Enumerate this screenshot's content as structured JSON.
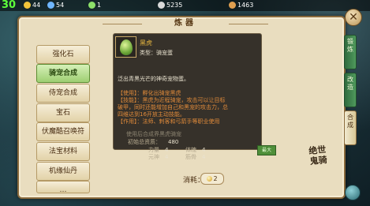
{
  "status_bar": {
    "fps": "30",
    "items": [
      {
        "icon": "gold-ingot-icon",
        "value": "44",
        "color": "#f2c43a"
      },
      {
        "icon": "gem-icon",
        "value": "54",
        "color": "#6fb6ff"
      },
      {
        "icon": "jade-icon",
        "value": "1",
        "color": "#8de06a"
      },
      {
        "icon": "silver-icon",
        "value": "5235",
        "color": "#d9d9d9"
      },
      {
        "icon": "copper-icon",
        "value": "1463",
        "color": "#e0a050"
      }
    ]
  },
  "panel": {
    "title": "炼器"
  },
  "menu": {
    "items": [
      {
        "label": "强化石",
        "active": false
      },
      {
        "label": "骑宠合成",
        "active": true
      },
      {
        "label": "侍宠合成",
        "active": false
      },
      {
        "label": "宝石",
        "active": false
      },
      {
        "label": "伏魔酷召唤符",
        "active": false
      },
      {
        "label": "法宝材料",
        "active": false
      },
      {
        "label": "机缘仙丹",
        "active": false
      },
      {
        "label": "…",
        "active": false
      }
    ]
  },
  "side_tabs": [
    {
      "label": "锻炼",
      "active": false
    },
    {
      "label": "改造",
      "active": false
    },
    {
      "label": "合成",
      "active": true
    }
  ],
  "tooltip": {
    "name": "黑虎",
    "type_label": "类型：骑宠蛋",
    "description": "泛出青黑光芒的神奇宠物蛋。",
    "detail_lines": [
      "【使用】：孵化出骑宠黑虎",
      "【技能】：黑虎为近程骑宠，攻击可以让目标",
      "破甲，同时还能增加自己和黑宠的攻击力，总",
      "四维达到16开放主动技能。",
      "【作用】：法师、刺客和弓箭手等职业使用"
    ],
    "combo_hint": "使用后合成界黑虎骑宠",
    "initial_label": "初始总资质：",
    "initial_value": "480",
    "stats": [
      {
        "label": "力量",
        "value": "4"
      },
      {
        "label": "体魄",
        "value": "4"
      },
      {
        "label": "元神",
        "value": "4"
      },
      {
        "label": "筋骨",
        "value": "4"
      }
    ],
    "tag": "最大"
  },
  "cost": {
    "label": "消耗：",
    "value": "2"
  },
  "watermark": "绝世\n鬼骑"
}
